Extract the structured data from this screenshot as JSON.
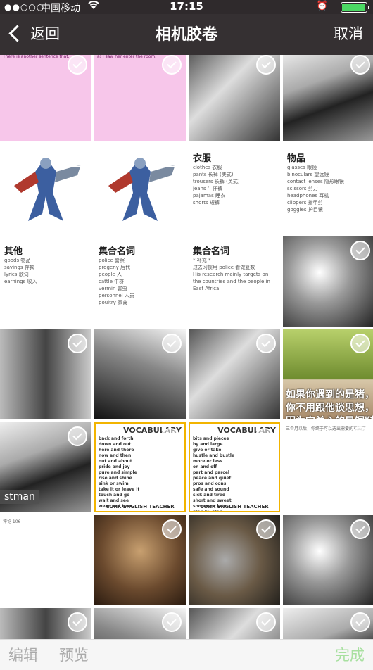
{
  "status_bar": {
    "signal": "●●○○○",
    "carrier": "中国移动",
    "wifi_icon": "wifi-icon",
    "time": "17:15",
    "alarm_icon": "alarm-icon",
    "battery_level": 1.0
  },
  "nav": {
    "back_label": "返回",
    "title": "相机胶卷",
    "cancel_label": "取消"
  },
  "grid": {
    "cells": [
      {
        "kind": "pinkdoc",
        "text": "There is another sentence that..."
      },
      {
        "kind": "pinkdoc",
        "text": "a) I saw her enter the room."
      },
      {
        "kind": "photo",
        "text": ""
      },
      {
        "kind": "photo",
        "text": ""
      },
      {
        "kind": "robot",
        "text": ""
      },
      {
        "kind": "robot",
        "text": ""
      },
      {
        "kind": "doc",
        "heading": "衣服",
        "lines": [
          "clothes 衣服",
          "pants 长裤 (美式)",
          "trousers 长裤 (英式)",
          "jeans 牛仔裤",
          "pajamas 睡衣",
          "shorts 短裤"
        ]
      },
      {
        "kind": "doc",
        "heading": "物品",
        "lines": [
          "glasses 眼镜",
          "binoculars 望远镜",
          "contact lenses 隐形眼镜",
          "scissors 剪刀",
          "headphones 耳机",
          "clippers 指甲剪",
          "goggles 护目镜"
        ]
      },
      {
        "kind": "doc",
        "heading": "其他",
        "lines": [
          "goods 物品",
          "savings 存款",
          "lyrics 歌词",
          "earnings 收入"
        ]
      },
      {
        "kind": "doc",
        "heading": "集合名词",
        "lines": [
          "police 警察",
          "progeny 后代",
          "people 人",
          "cattle 牛群",
          "vermin 害虫",
          "personnel 人员",
          "poultry 家禽"
        ]
      },
      {
        "kind": "doc",
        "heading": "集合名词",
        "lines": [
          "* 补充 *",
          "过去习惯用 police 看做复数",
          "His research mainly targets on the countries and the people in East Africa."
        ]
      },
      {
        "kind": "photo",
        "text": ""
      },
      {
        "kind": "photo",
        "text": ""
      },
      {
        "kind": "photo",
        "text": ""
      },
      {
        "kind": "photo",
        "text": ""
      },
      {
        "kind": "pig",
        "text": "如果你遇到的是猪，你不用跟他谈思想，因为它关心的是饲料"
      },
      {
        "kind": "photo",
        "tag": "stman"
      },
      {
        "kind": "vocab",
        "title": "VOCABULARY",
        "words": [
          "back and forth",
          "down and out",
          "here and there",
          "now and then",
          "out and about",
          "pride and joy",
          "pure and simple",
          "rise and shine",
          "sink or swim",
          "take it or leave it",
          "touch and go",
          "wait and see",
          "wear and tear"
        ],
        "footer": "CORK ENGLISH TEACHER"
      },
      {
        "kind": "vocab",
        "title": "VOCABULARY",
        "words": [
          "bits and pieces",
          "by and large",
          "give or take",
          "hustle and bustle",
          "more or less",
          "on and off",
          "part and parcel",
          "peace and quiet",
          "pros and cons",
          "safe and sound",
          "sick and tired",
          "short and sweet",
          "sooner or later",
          "step by step"
        ],
        "footer": "CORK ENGLISH TEACHER"
      },
      {
        "kind": "social",
        "text": "三个月以后，你终于可以选出需要的东西了"
      },
      {
        "kind": "social",
        "text": "评论 106"
      },
      {
        "kind": "cat",
        "text": ""
      },
      {
        "kind": "cat2",
        "text": ""
      },
      {
        "kind": "photo",
        "text": ""
      },
      {
        "kind": "photo",
        "text": ""
      },
      {
        "kind": "photo",
        "text": ""
      },
      {
        "kind": "photo",
        "text": ""
      },
      {
        "kind": "photo",
        "text": ""
      }
    ]
  },
  "bottom": {
    "edit_label": "编辑",
    "preview_label": "预览",
    "done_label": "完成"
  }
}
